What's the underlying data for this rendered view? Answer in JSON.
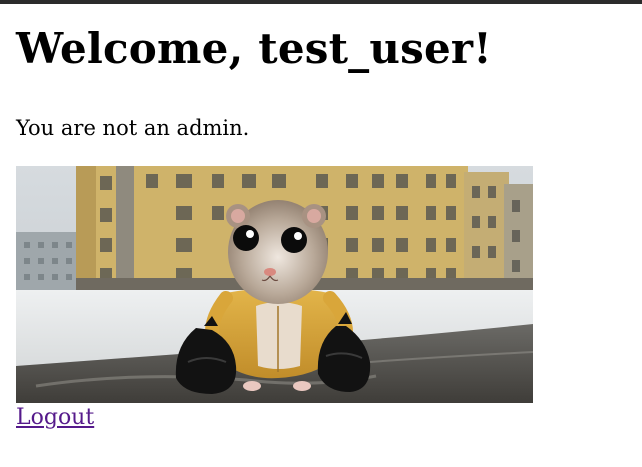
{
  "page": {
    "heading": "Welcome, test_user!",
    "status_text": "You are not an admin.",
    "logout_label": "Logout",
    "link_color": "#551a8b"
  },
  "image": {
    "description_name": "hamster-photo"
  }
}
